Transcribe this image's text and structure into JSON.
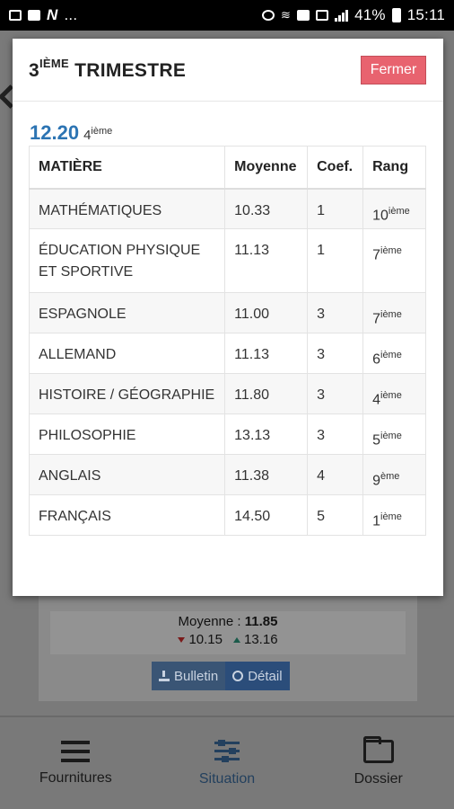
{
  "status_bar": {
    "dots": "...",
    "battery": "41%",
    "time": "15:11"
  },
  "background": {
    "moyenne_label": "Moyenne :",
    "moyenne_value": "11.85",
    "min_value": "10.15",
    "max_value": "13.16",
    "bulletin_label": "Bulletin",
    "detail_label": "Détail"
  },
  "bottom_nav": {
    "items": [
      {
        "label": "Fournitures"
      },
      {
        "label": "Situation"
      },
      {
        "label": "Dossier"
      }
    ]
  },
  "modal": {
    "title_prefix": "3",
    "title_sup": "IÈME",
    "title_suffix": "TRIMESTRE",
    "close_label": "Fermer",
    "average": "12.20",
    "rank_num": "4",
    "rank_sup": "ième",
    "headers": [
      "MATIÈRE",
      "Moyenne",
      "Coef.",
      "Rang"
    ],
    "rows": [
      {
        "subject": "MATHÉMATIQUES",
        "avg": "10.33",
        "coef": "1",
        "rank": "10",
        "rank_sup": "ième"
      },
      {
        "subject": "ÉDUCATION PHYSIQUE ET SPORTIVE",
        "avg": "11.13",
        "coef": "1",
        "rank": "7",
        "rank_sup": "ième"
      },
      {
        "subject": "ESPAGNOLE",
        "avg": "11.00",
        "coef": "3",
        "rank": "7",
        "rank_sup": "ième"
      },
      {
        "subject": "ALLEMAND",
        "avg": "11.13",
        "coef": "3",
        "rank": "6",
        "rank_sup": "ième"
      },
      {
        "subject": "HISTOIRE / GÉOGRAPHIE",
        "avg": "11.80",
        "coef": "3",
        "rank": "4",
        "rank_sup": "ième"
      },
      {
        "subject": "PHILOSOPHIE",
        "avg": "13.13",
        "coef": "3",
        "rank": "5",
        "rank_sup": "ième"
      },
      {
        "subject": "ANGLAIS",
        "avg": "11.38",
        "coef": "4",
        "rank": "9",
        "rank_sup": "ème"
      },
      {
        "subject": "FRANÇAIS",
        "avg": "14.50",
        "coef": "5",
        "rank": "1",
        "rank_sup": "ième"
      }
    ]
  }
}
